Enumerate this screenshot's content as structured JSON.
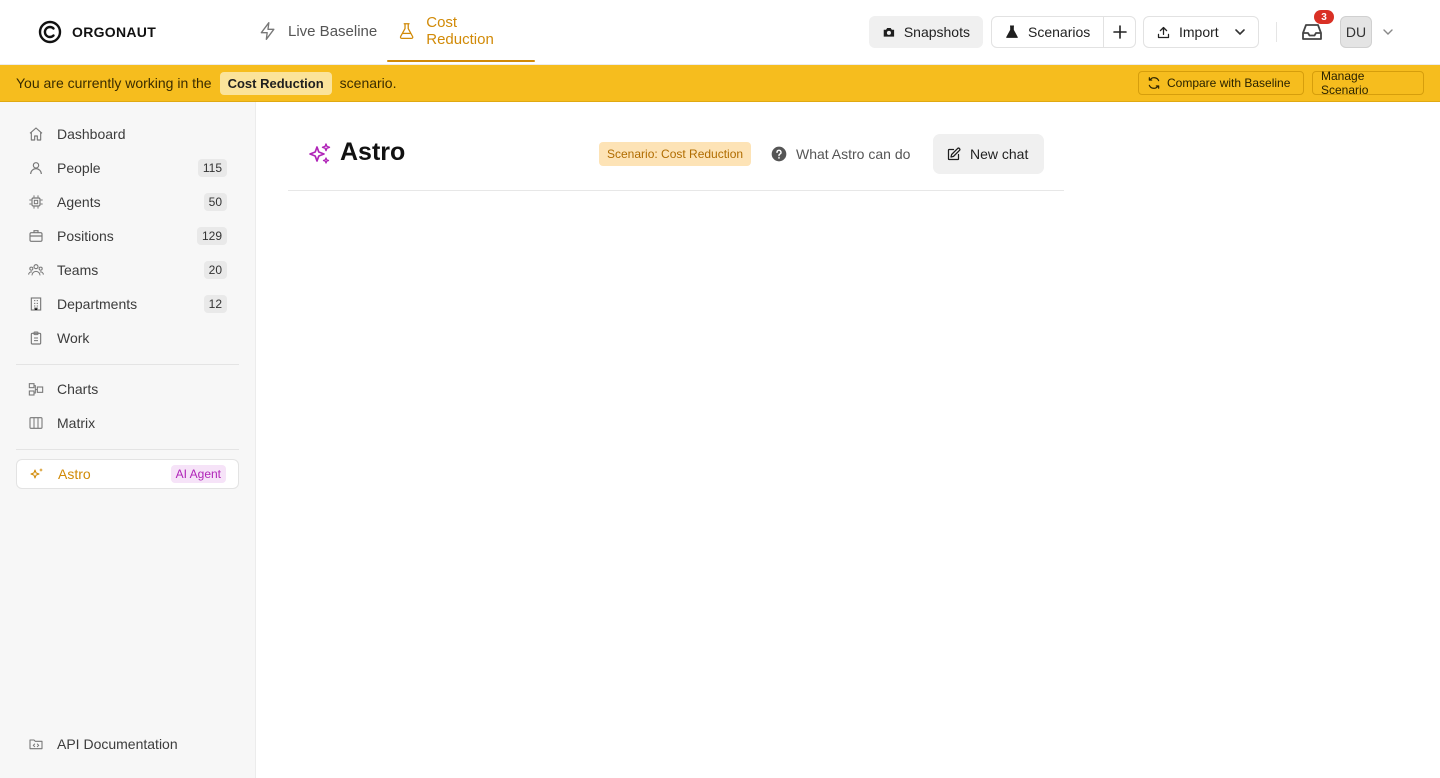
{
  "app": {
    "name": "ORGONAUT"
  },
  "header": {
    "tabs": [
      {
        "label": "Live Baseline",
        "icon": "bolt-icon",
        "active": false
      },
      {
        "label": "Cost Reduction",
        "icon": "flask-icon",
        "active": true
      }
    ],
    "snapshots_label": "Snapshots",
    "scenarios_label": "Scenarios",
    "import_label": "Import",
    "notifications_count": "3",
    "avatar_initials": "DU"
  },
  "banner": {
    "prefix": "You are currently working in the",
    "scenario": "Cost Reduction",
    "suffix": "scenario.",
    "compare_label": "Compare with Baseline",
    "manage_label": "Manage Scenario"
  },
  "sidebar": {
    "items": [
      {
        "label": "Dashboard",
        "icon": "home-icon"
      },
      {
        "label": "People",
        "icon": "person-icon",
        "count": "115"
      },
      {
        "label": "Agents",
        "icon": "chip-icon",
        "count": "50"
      },
      {
        "label": "Positions",
        "icon": "briefcase-icon",
        "count": "129"
      },
      {
        "label": "Teams",
        "icon": "team-icon",
        "count": "20"
      },
      {
        "label": "Departments",
        "icon": "building-icon",
        "count": "12"
      },
      {
        "label": "Work",
        "icon": "clipboard-icon"
      },
      {
        "label": "Charts",
        "icon": "org-chart-icon"
      },
      {
        "label": "Matrix",
        "icon": "matrix-icon"
      }
    ],
    "astro": {
      "label": "Astro",
      "badge": "AI Agent",
      "icon": "sparkles-icon"
    },
    "api_docs": {
      "label": "API Documentation",
      "icon": "folder-code-icon"
    }
  },
  "main": {
    "title": "Astro",
    "scenario_chip": "Scenario: Cost Reduction",
    "help_label": "What Astro can do",
    "new_chat_label": "New chat"
  },
  "colors": {
    "accent": "#d18a07",
    "banner": "#f6bd1e",
    "ai_purple": "#b024b8",
    "notification_red": "#d93025"
  }
}
